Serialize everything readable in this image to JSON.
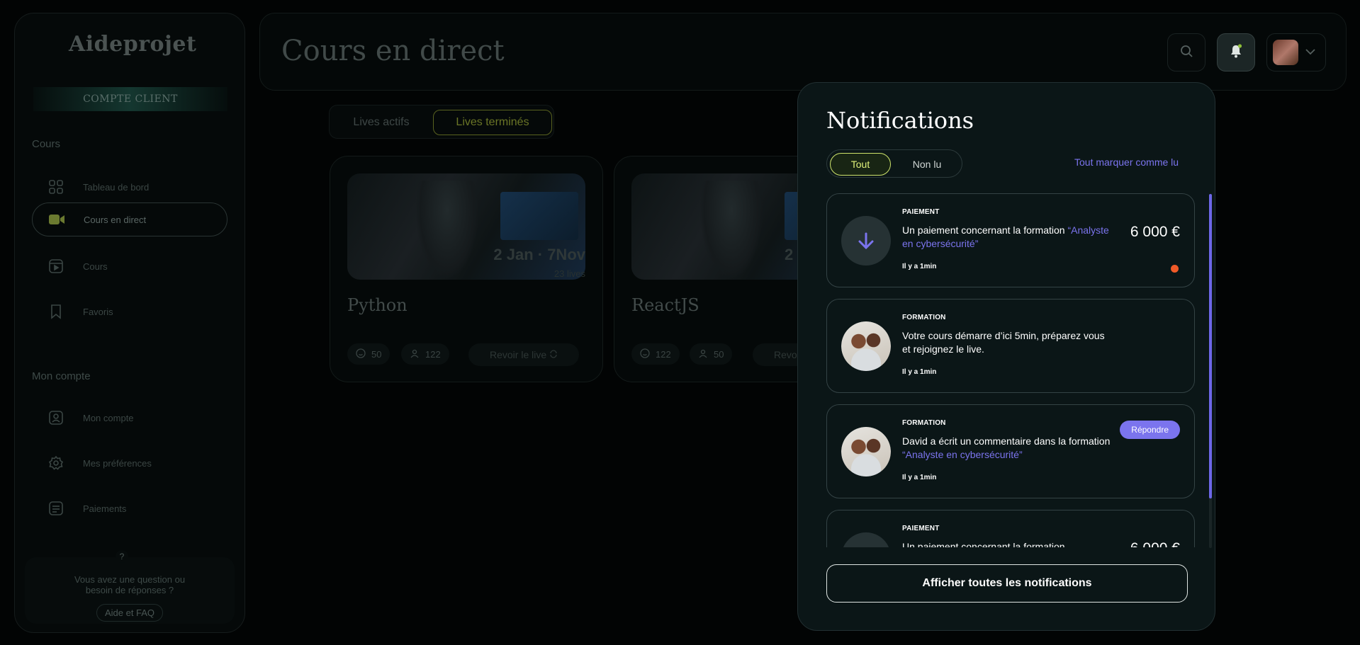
{
  "sidebar": {
    "logo": "Aideprojet",
    "account_type": "COMPTE CLIENT",
    "section_courses": "Cours",
    "section_account": "Mon compte",
    "items": [
      {
        "label": "Tableau de bord",
        "icon": "grid-icon"
      },
      {
        "label": "Cours en direct",
        "icon": "video-camera-icon",
        "active": true
      },
      {
        "label": "Cours",
        "icon": "play-square-icon"
      },
      {
        "label": "Favoris",
        "icon": "bookmark-icon"
      },
      {
        "label": "Mon compte",
        "icon": "user-card-icon"
      },
      {
        "label": "Mes préférences",
        "icon": "gear-icon"
      },
      {
        "label": "Paiements",
        "icon": "receipt-icon"
      }
    ],
    "help": {
      "question_mark": "?",
      "text_line1": "Vous avez une question ou",
      "text_line2": "besoin de réponses ?",
      "button": "Aide et FAQ"
    }
  },
  "header": {
    "title": "Cours en direct"
  },
  "live_tabs": {
    "active": "Lives actifs",
    "ended": "Lives terminés",
    "selected": "Lives terminés"
  },
  "cards": [
    {
      "title": "Python",
      "date_range": "2 Jan · 7Nov",
      "lives": "23 lives",
      "stat1": "50",
      "stat2": "122",
      "replay": "Revoir le live"
    },
    {
      "title": "ReactJS",
      "date_range": "2",
      "stat1": "122",
      "stat2": "50",
      "replay": "Revo"
    }
  ],
  "notifications": {
    "title": "Notifications",
    "filter_all": "Tout",
    "filter_unread": "Non lu",
    "filter_selected": "Tout",
    "mark_all": "Tout marquer comme lu",
    "show_all": "Afficher toutes les notifications",
    "items": [
      {
        "category": "PAIEMENT",
        "text": "Un paiement concernant la formation ",
        "link": "“Analyste en cybersécurité”",
        "time": "Il y a 1min",
        "amount": "6 000 €",
        "unread": true
      },
      {
        "category": "FORMATION",
        "text": "Votre cours démarre d’ici 5min, préparez vous et rejoignez le live.",
        "link": "",
        "time": "Il y a 1min"
      },
      {
        "category": "FORMATION",
        "text": "David a écrit un commentaire dans la formation ",
        "link": "“Analyste en cybersécurité”",
        "time": "Il y a 1min",
        "action": "Répondre"
      },
      {
        "category": "PAIEMENT",
        "text": "Un paiement concernant la formation",
        "link": "",
        "amount": "6 000 €"
      }
    ]
  },
  "colors": {
    "accent": "#7b74ee",
    "lime": "#dff07a",
    "unread_dot": "#f05a28",
    "panel_bg": "#0b1617"
  }
}
